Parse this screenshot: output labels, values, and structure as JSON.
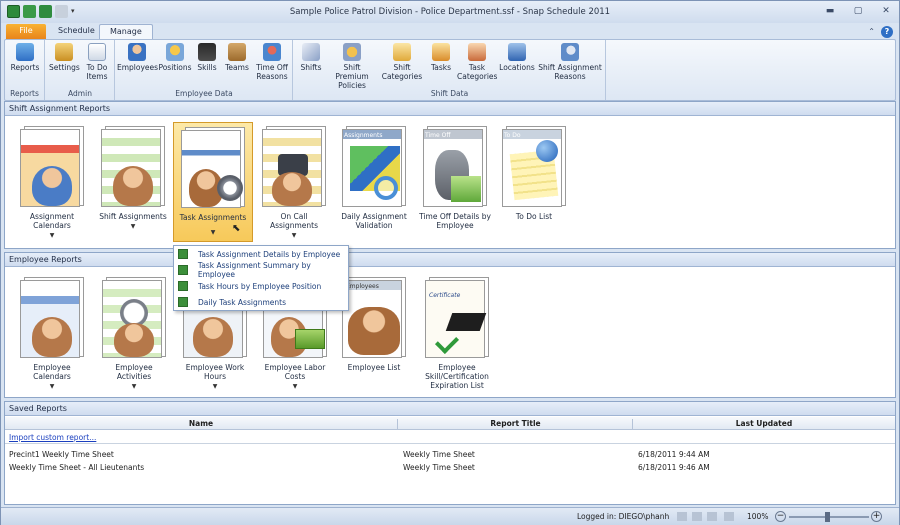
{
  "window": {
    "title": "Sample Police Patrol Division - Police Department.ssf - Snap Schedule 2011"
  },
  "tabs": [
    {
      "label": "File"
    },
    {
      "label": "Schedule"
    },
    {
      "label": "Manage"
    }
  ],
  "ribbon": {
    "groups": [
      {
        "label": "Reports",
        "buttons": [
          "Reports"
        ]
      },
      {
        "label": "Admin",
        "buttons": [
          "Settings",
          "To Do Items"
        ]
      },
      {
        "label": "Employee Data",
        "buttons": [
          "Employees",
          "Positions",
          "Skills",
          "Teams",
          "Time Off Reasons"
        ]
      },
      {
        "label": "Shift Data",
        "buttons": [
          "Shifts",
          "Shift Premium Policies",
          "Shift Categories",
          "Tasks",
          "Task Categories",
          "Locations",
          "Shift Assignment Reasons"
        ]
      }
    ]
  },
  "shift_reports": {
    "header": "Shift Assignment Reports",
    "tiles": [
      {
        "label": "Assignment Calendars",
        "caret": "▼"
      },
      {
        "label": "Shift Assignments",
        "caret": "▼"
      },
      {
        "label": "Task Assignments",
        "caret": "▼"
      },
      {
        "label": "On Call Assignments",
        "caret": "▼"
      },
      {
        "label": "Daily Assignment Validation",
        "caret": ""
      },
      {
        "label": "Time Off Details by Employee",
        "caret": ""
      },
      {
        "label": "To Do List",
        "caret": ""
      }
    ],
    "thumb_titles": {
      "daily": "Assignments",
      "timeoff": "Time Off",
      "todo": "To Do"
    }
  },
  "task_menu": {
    "items": [
      "Task Assignment Details by Employee",
      "Task Assignment Summary by Employee",
      "Task Hours by Employee Position",
      "Daily Task Assignments"
    ]
  },
  "employee_reports": {
    "header": "Employee Reports",
    "tiles": [
      {
        "label": "Employee Calendars",
        "caret": "▼"
      },
      {
        "label": "Employee Activities",
        "caret": "▼"
      },
      {
        "label": "Employee Work Hours",
        "caret": "▼"
      },
      {
        "label": "Employee Labor Costs",
        "caret": "▼"
      },
      {
        "label": "Employee List",
        "caret": ""
      },
      {
        "label": "Employee Skill/Certification Expiration List",
        "caret": ""
      }
    ],
    "thumb_titles": {
      "list": "Employees",
      "cert": "Certificate"
    }
  },
  "saved_reports": {
    "header": "Saved Reports",
    "columns": [
      "Name",
      "Report Title",
      "Last Updated"
    ],
    "import_link": "Import custom report...",
    "rows": [
      {
        "name": "Precint1 Weekly Time Sheet",
        "title": "Weekly Time Sheet",
        "updated": "6/18/2011 9:44 AM"
      },
      {
        "name": "Weekly Time Sheet - All Lieutenants",
        "title": "Weekly Time Sheet",
        "updated": "6/18/2011 9:46 AM"
      }
    ]
  },
  "status": {
    "logged_in": "Logged in: DIEGO\\phanh",
    "zoom": "100%"
  },
  "colors": {
    "accent": "#2f6fc5",
    "file_tab": "#e8841b",
    "selected_tile": "#f7c95a"
  }
}
